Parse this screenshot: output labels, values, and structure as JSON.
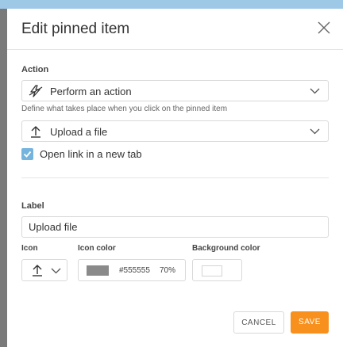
{
  "dialog": {
    "title": "Edit pinned item",
    "close_icon": "close-icon"
  },
  "action": {
    "label": "Action",
    "selected": "Perform an action",
    "selected_icon": "bolt-slash-icon",
    "hint": "Define what takes place when you click on the pinned item",
    "sub_selected": "Upload a file",
    "sub_selected_icon": "upload-arrow-icon",
    "open_new_tab_label": "Open link in a new tab",
    "open_new_tab_checked": true
  },
  "label": {
    "heading": "Label",
    "value": "Upload file"
  },
  "icon": {
    "heading": "Icon",
    "selected_icon": "upload-arrow-icon"
  },
  "icon_color": {
    "heading": "Icon color",
    "hex": "#555555",
    "opacity": "70%",
    "swatch_color": "#8a8a8a"
  },
  "background_color": {
    "heading": "Background color",
    "swatch_color": "#ffffff"
  },
  "buttons": {
    "cancel": "CANCEL",
    "save": "SAVE"
  },
  "colors": {
    "accent": "#f8901e",
    "checkbox": "#74b4dd"
  }
}
